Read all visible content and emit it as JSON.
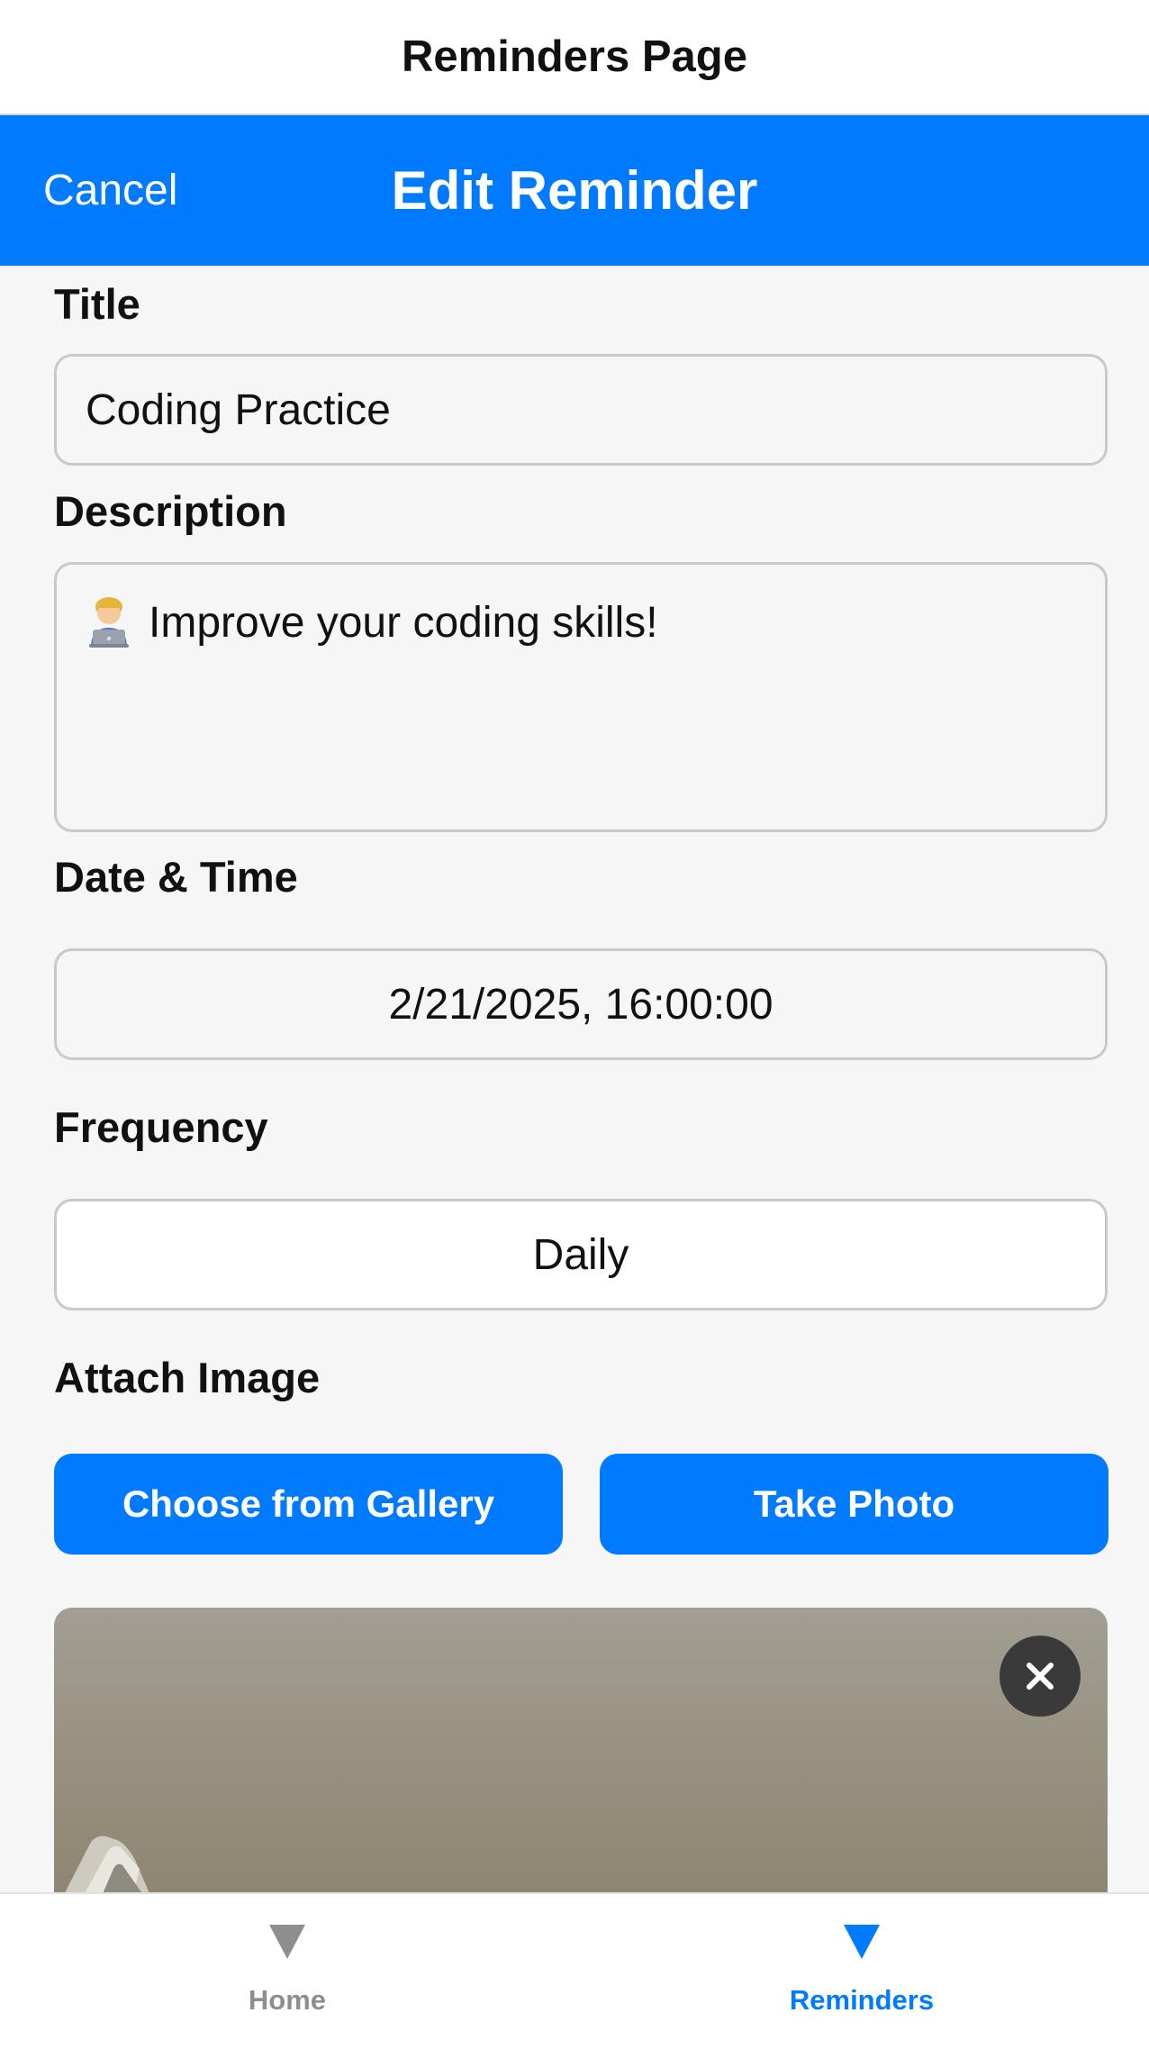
{
  "header": {
    "title": "Reminders Page"
  },
  "nav": {
    "cancel_label": "Cancel",
    "title": "Edit Reminder"
  },
  "form": {
    "title_label": "Title",
    "title_value": "Coding Practice",
    "description_label": "Description",
    "description_emoji": "👨‍💻",
    "description_value": "Improve your coding skills!",
    "datetime_label": "Date & Time",
    "datetime_value": "2/21/2025, 16:00:00",
    "frequency_label": "Frequency",
    "frequency_value": "Daily",
    "attach_label": "Attach Image",
    "gallery_button": "Choose from Gallery",
    "photo_button": "Take Photo"
  },
  "tabs": [
    {
      "label": "Home",
      "icon": "triangle-down-icon",
      "active": false,
      "color": "#8e8e8e"
    },
    {
      "label": "Reminders",
      "icon": "triangle-down-icon",
      "active": true,
      "color": "#007aff"
    }
  ],
  "colors": {
    "accent": "#007aff",
    "inactive": "#8e8e8e",
    "remove_button": "#3a3a3a"
  }
}
